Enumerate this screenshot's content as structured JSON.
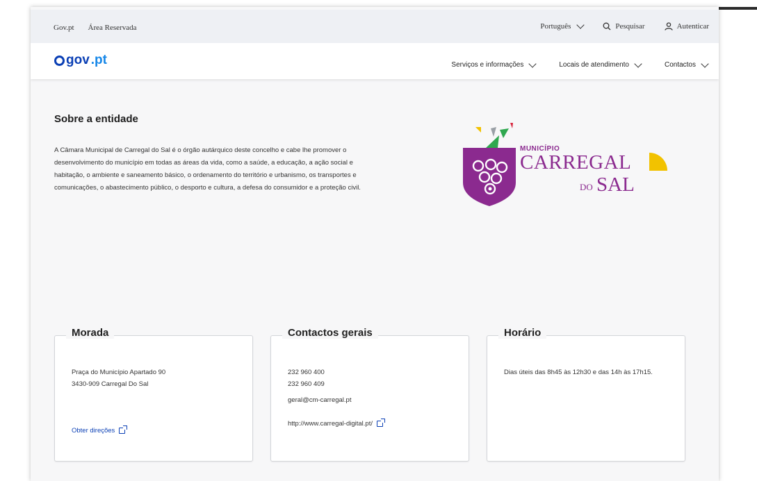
{
  "utility_bar": {
    "links": [
      "Gov.pt",
      "Área Reservada"
    ],
    "language": "Português",
    "search": "Pesquisar",
    "login": "Autenticar"
  },
  "main_nav": {
    "logo": {
      "gov": "gov",
      "pt": ".pt"
    },
    "links": [
      "Serviços e informações",
      "Locais de atendimento",
      "Contactos"
    ]
  },
  "about": {
    "title": "Sobre a entidade",
    "text": "A Câmara Municipal de Carregal do Sal é o órgão autárquico deste concelho e cabe lhe promover o desenvolvimento do município em todas as áreas da vida, como a saúde, a educação, a ação social e habitação, o ambiente e saneamento básico, o ordenamento do território e urbanismo, os transportes e comunicações, o abastecimento público, o desporto e cultura, a defesa do consumidor e a proteção civil."
  },
  "municipality_logo": {
    "small": "MUNICÍPIO",
    "big": "CARREGAL",
    "do": "DO",
    "sal": "SAL",
    "colors": {
      "purple": "#8b2a8f",
      "yellow": "#f2c200",
      "green": "#2fa84f",
      "red": "#d7263d",
      "grey": "#9aa0a6"
    }
  },
  "cards": {
    "morada": {
      "title": "Morada",
      "line1": "Praça do Município Apartado 90",
      "line2": "3430-909 Carregal Do Sal",
      "link": "Obter direções"
    },
    "contactos": {
      "title": "Contactos gerais",
      "phone1": "232 960 400",
      "phone2": "232 960 409",
      "email": "geral@cm-carregal.pt",
      "website": "http://www.carregal-digital.pt/"
    },
    "horario": {
      "title": "Horário",
      "text": "Dias úteis das 8h45 às 12h30 e das 14h às 17h15."
    }
  },
  "colors": {
    "primary": "#0a3fb5",
    "accent": "#1687e8"
  }
}
